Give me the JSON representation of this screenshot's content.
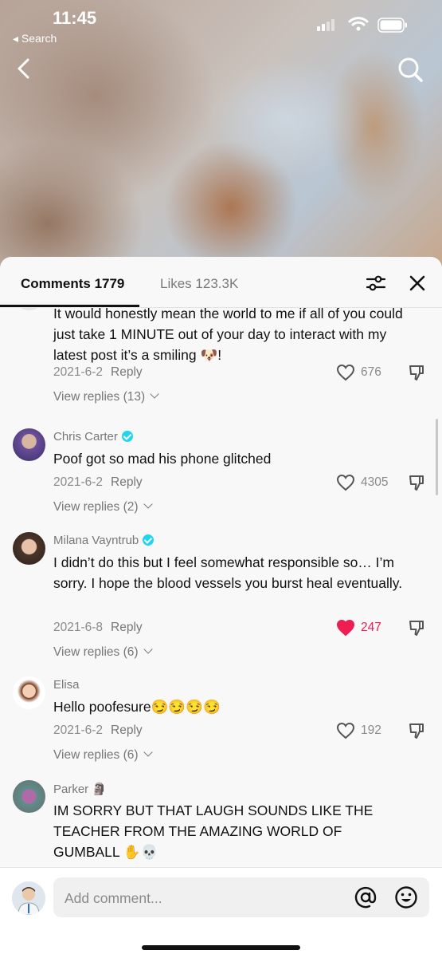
{
  "status_bar": {
    "time": "11:45",
    "back_app": "Search"
  },
  "tabs": {
    "comments": "Comments 1779",
    "likes": "Likes 123.3K"
  },
  "comments": [
    {
      "name": "",
      "text": "It would honestly mean the world to me if all of you could just take 1 MINUTE out of your day to interact with my latest post it’s a smiling 🐶!",
      "date": "2021-6-2",
      "reply": "Reply",
      "likes": "676",
      "liked": false,
      "view_replies": "View replies (13)"
    },
    {
      "name": "Chris Carter",
      "verified": true,
      "text": "Poof got so mad his phone glitched",
      "date": "2021-6-2",
      "reply": "Reply",
      "likes": "4305",
      "liked": false,
      "view_replies": "View replies (2)"
    },
    {
      "name": "Milana Vayntrub",
      "verified": true,
      "text": "I didn’t do this but I feel somewhat responsible so… I’m sorry. I hope the blood vessels you burst heal eventually.",
      "date": "2021-6-8",
      "reply": "Reply",
      "likes": "247",
      "liked": true,
      "view_replies": "View replies (6)"
    },
    {
      "name": "Elisa",
      "verified": false,
      "text": "Hello poofesure😏😏😏😏",
      "date": "2021-6-2",
      "reply": "Reply",
      "likes": "192",
      "liked": false,
      "view_replies": "View replies (6)"
    },
    {
      "name": "Parker 🗿",
      "verified": false,
      "text": "IM SORRY BUT THAT LAUGH SOUNDS LIKE THE TEACHER FROM THE AMAZING WORLD OF GUMBALL ✋💀",
      "date": "",
      "reply": "",
      "likes": "",
      "liked": false,
      "view_replies": ""
    }
  ],
  "composer": {
    "placeholder": "Add comment..."
  },
  "colors": {
    "liked_heart": "#ee1d52",
    "verified_badge": "#20d5ec"
  },
  "icons": [
    "back-icon",
    "search-icon",
    "filter-icon",
    "close-icon",
    "heart-icon",
    "dislike-icon",
    "at-icon",
    "emoji-icon"
  ]
}
